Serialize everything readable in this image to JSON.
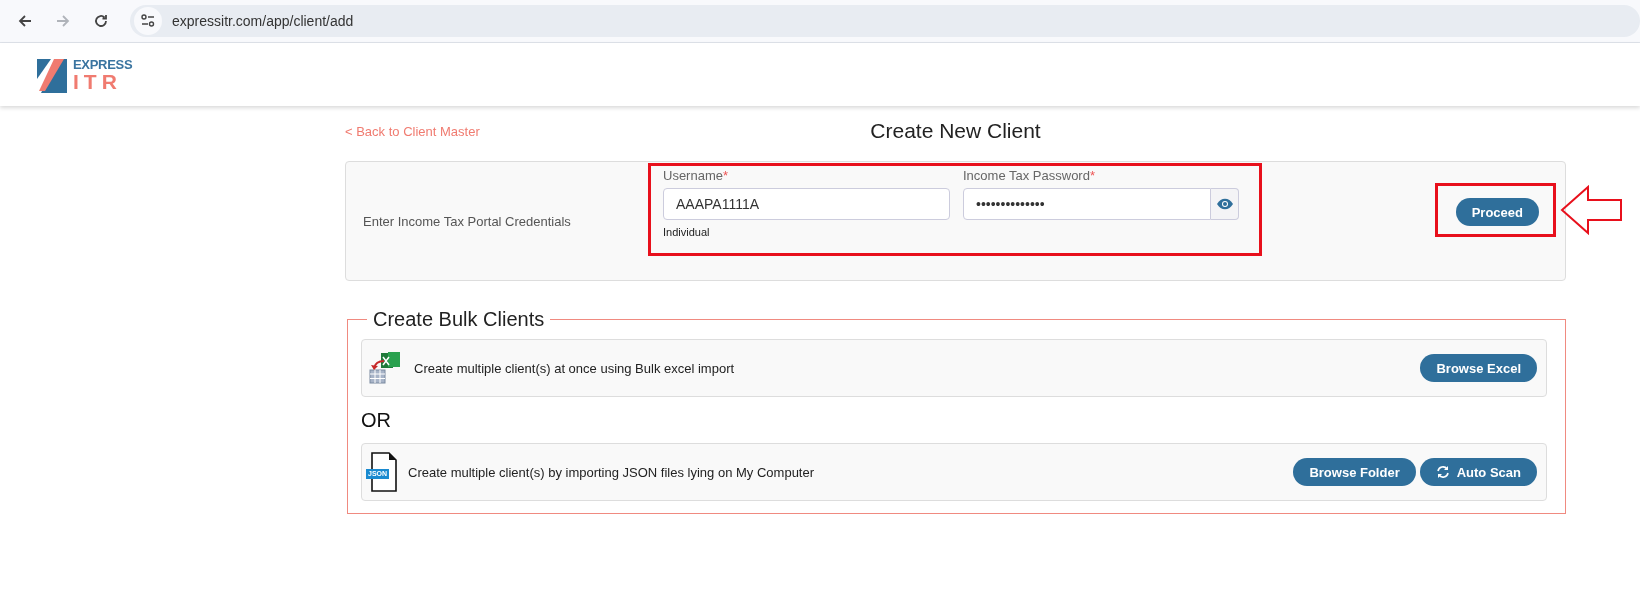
{
  "browser": {
    "nav": [
      {
        "kind": "back",
        "disabled": false
      },
      {
        "kind": "forward",
        "disabled": true
      },
      {
        "kind": "reload",
        "disabled": false
      }
    ],
    "url": "expressitr.com/app/client/add"
  },
  "logo": {
    "top": "EXPRESS",
    "bottom": "ITR"
  },
  "back_link": "< Back to Client Master",
  "title": "Create New Client",
  "credentials": {
    "label": "Enter Income Tax Portal Credentials",
    "fields": [
      {
        "kind": "text",
        "label": "Username",
        "required_mark": "*",
        "value": "AAAPA1111A"
      },
      {
        "kind": "password",
        "label": "Income Tax Password",
        "required_mark": "*",
        "value": "••••••••••••••"
      }
    ],
    "hint": "Individual",
    "button": "Proceed"
  },
  "annotations": {
    "highlight_fields": true,
    "highlight_proceed": true,
    "pointer_arrow": true
  },
  "bulk": {
    "legend": "Create Bulk Clients",
    "separator": "OR",
    "options": [
      {
        "kind": "excel",
        "text": "Create multiple client(s) at once using Bulk excel import",
        "buttons": [
          {
            "kind": "browse",
            "label": "Browse Excel"
          }
        ]
      },
      {
        "kind": "json",
        "icon_label": "JSON",
        "text": "Create multiple client(s) by importing JSON files lying on My Computer",
        "buttons": [
          {
            "kind": "browse",
            "label": "Browse Folder"
          },
          {
            "kind": "scan",
            "label": "Auto Scan"
          }
        ]
      }
    ]
  }
}
